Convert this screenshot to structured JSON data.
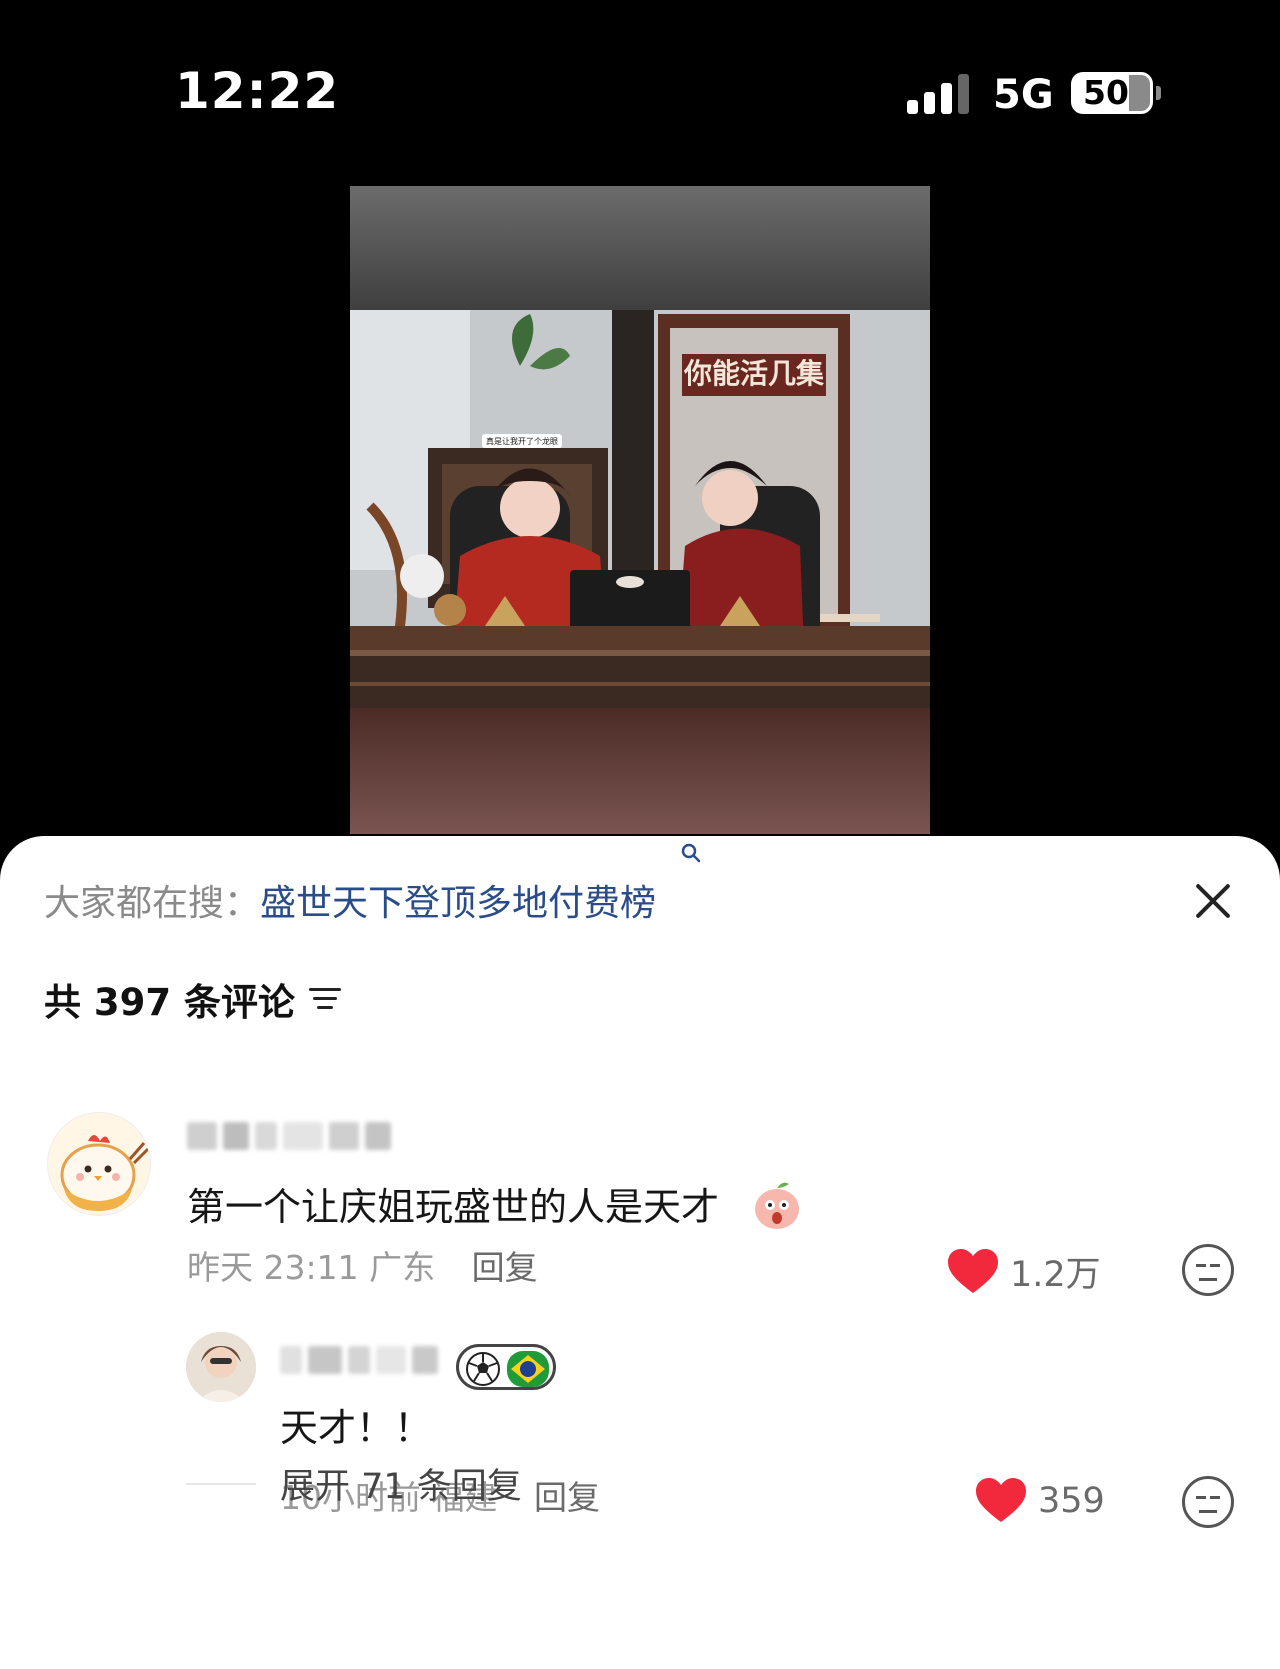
{
  "status_bar": {
    "time": "12:22",
    "network": "5G",
    "battery": "50"
  },
  "video": {
    "sign_text": "你能活几集",
    "caption_text": "真是让我开了个龙眼"
  },
  "comments_panel": {
    "hot_search_label": "大家都在搜：",
    "hot_search_query": "盛世天下登顶多地付费榜",
    "total_count": "共 397 条评论",
    "comments": [
      {
        "text": "第一个让庆姐玩盛世的人是天才",
        "time": "昨天 23:11",
        "location": "广东",
        "reply_label": "回复",
        "likes": "1.2万",
        "emoji_icon": "peach-face-emoji-icon"
      }
    ],
    "replies": [
      {
        "text": "天才！！",
        "time": "10小时前",
        "location": "福建",
        "reply_label": "回复",
        "likes": "359",
        "badge_icons": [
          "soccer-ball-icon",
          "brazil-flag-icon"
        ]
      }
    ],
    "expand_label": "展开 71 条回复"
  },
  "colors": {
    "like_red": "#f2293c",
    "link_blue": "#2a4d8a",
    "meta_gray": "#9a9a9a"
  }
}
